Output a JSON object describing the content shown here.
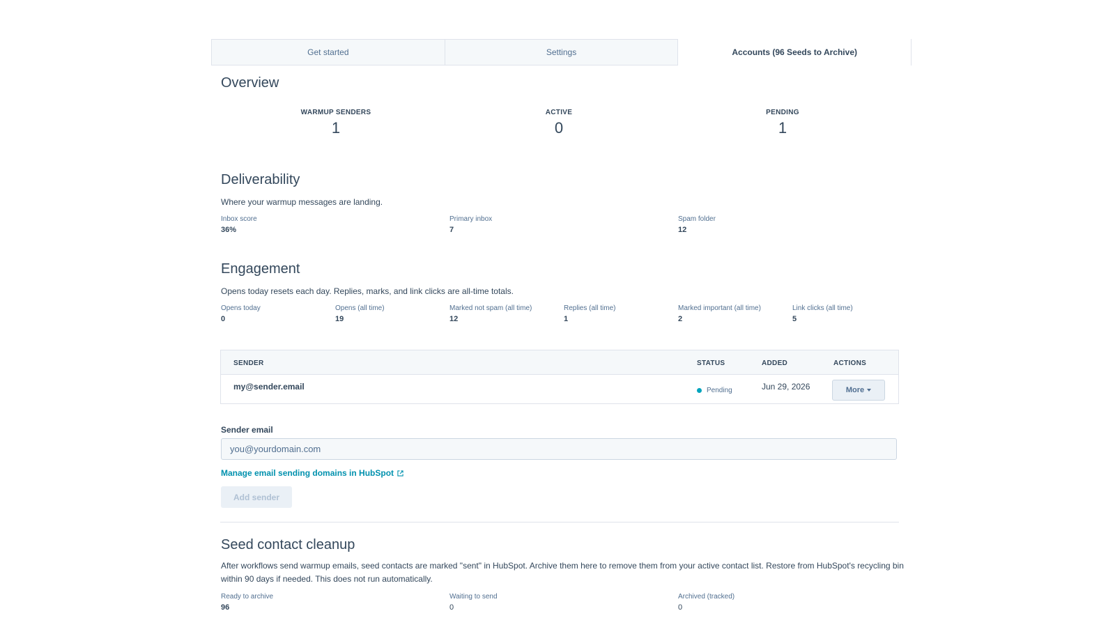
{
  "tabs": [
    {
      "label": "Get started"
    },
    {
      "label": "Settings"
    },
    {
      "label": "Accounts (96 Seeds to Archive)"
    }
  ],
  "overview": {
    "title": "Overview",
    "stats": [
      {
        "label": "WARMUP SENDERS",
        "value": "1"
      },
      {
        "label": "ACTIVE",
        "value": "0"
      },
      {
        "label": "PENDING",
        "value": "1"
      }
    ]
  },
  "deliverability": {
    "title": "Deliverability",
    "description": "Where your warmup messages are landing.",
    "metrics": [
      {
        "label": "Inbox score",
        "value": "36%"
      },
      {
        "label": "Primary inbox",
        "value": "7"
      },
      {
        "label": "Spam folder",
        "value": "12"
      }
    ]
  },
  "engagement": {
    "title": "Engagement",
    "description": "Opens today resets each day. Replies, marks, and link clicks are all-time totals.",
    "metrics": [
      {
        "label": "Opens today",
        "value": "0"
      },
      {
        "label": "Opens (all time)",
        "value": "19"
      },
      {
        "label": "Marked not spam (all time)",
        "value": "12"
      },
      {
        "label": "Replies (all time)",
        "value": "1"
      },
      {
        "label": "Marked important (all time)",
        "value": "2"
      },
      {
        "label": "Link clicks (all time)",
        "value": "5"
      }
    ]
  },
  "senders_table": {
    "columns": [
      "SENDER",
      "STATUS",
      "ADDED",
      "ACTIONS"
    ],
    "rows": [
      {
        "sender": "my@sender.email",
        "status": "Pending",
        "added": "Jun 29, 2026",
        "action": "More"
      }
    ]
  },
  "add_sender": {
    "label": "Sender email",
    "placeholder": "you@yourdomain.com",
    "link": "Manage email sending domains in HubSpot",
    "button": "Add sender"
  },
  "seed_cleanup": {
    "title": "Seed contact cleanup",
    "description_line1": "After workflows send warmup emails, seed contacts are marked \"sent\" in HubSpot. Archive them here to remove them from your active contact list. Restore from HubSpot's recycling bin",
    "description_line2": "within 90 days if needed. This does not run automatically.",
    "metrics": [
      {
        "label": "Ready to archive",
        "value": "96"
      },
      {
        "label": "Waiting to send",
        "value": "0"
      },
      {
        "label": "Archived (tracked)",
        "value": "0"
      }
    ]
  },
  "colors": {
    "accent": "#0091ae",
    "status_pending": "#00a4bd",
    "text": "#33475b"
  },
  "icons": [
    "external-link-icon",
    "caret-down-icon",
    "status-dot-icon"
  ]
}
